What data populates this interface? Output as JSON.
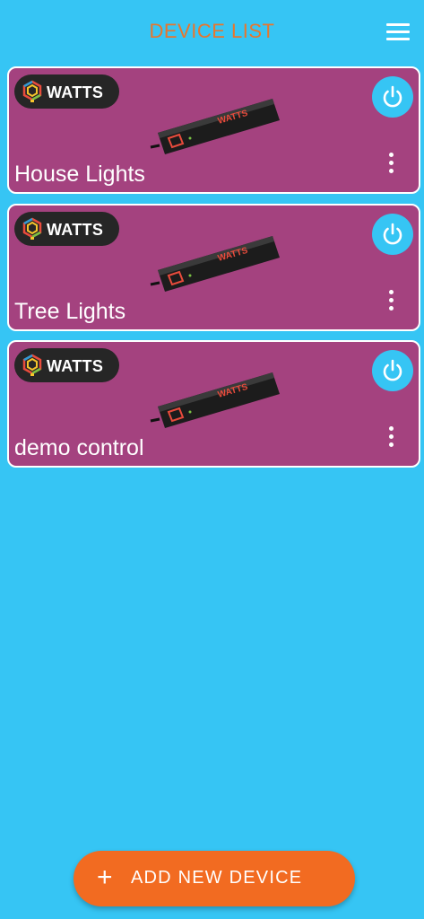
{
  "header": {
    "title": "DEVICE LIST",
    "menu_icon": "hamburger-menu-icon"
  },
  "devices": [
    {
      "name": "House Lights",
      "badge": "WATTS"
    },
    {
      "name": "Tree Lights",
      "badge": "WATTS"
    },
    {
      "name": "demo control",
      "badge": "WATTS"
    }
  ],
  "actions": {
    "add_icon": "+",
    "add_label": "ADD NEW DEVICE"
  },
  "colors": {
    "background": "#36c5f4",
    "title": "#e8762d",
    "card": "#a4427f",
    "badge": "#262626",
    "power_button": "#36c5f4",
    "add_button": "#f26b21"
  }
}
